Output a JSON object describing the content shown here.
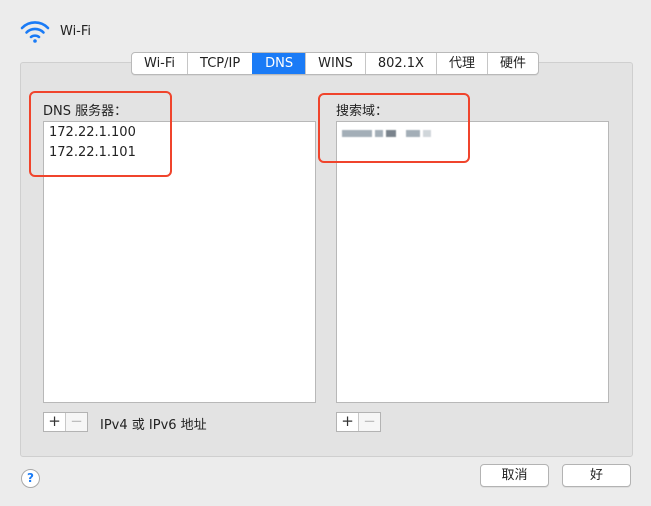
{
  "window": {
    "title": "Wi-Fi",
    "icon": "wifi-icon",
    "accent_color": "#1a7bf6"
  },
  "tabs": [
    {
      "label": "Wi-Fi",
      "active": false
    },
    {
      "label": "TCP/IP",
      "active": false
    },
    {
      "label": "DNS",
      "active": true
    },
    {
      "label": "WINS",
      "active": false
    },
    {
      "label": "802.1X",
      "active": false
    },
    {
      "label": "代理",
      "active": false
    },
    {
      "label": "硬件",
      "active": false
    }
  ],
  "dns": {
    "label": "DNS 服务器：",
    "servers": [
      "172.22.1.100",
      "172.22.1.101"
    ],
    "add_label": "+",
    "remove_label": "−",
    "note": "IPv4 或 IPv6 地址"
  },
  "search": {
    "label": "搜索域：",
    "add_label": "+",
    "remove_label": "−"
  },
  "footer": {
    "help_label": "?",
    "cancel_label": "取消",
    "ok_label": "好"
  },
  "highlight_color": "#f0442c"
}
